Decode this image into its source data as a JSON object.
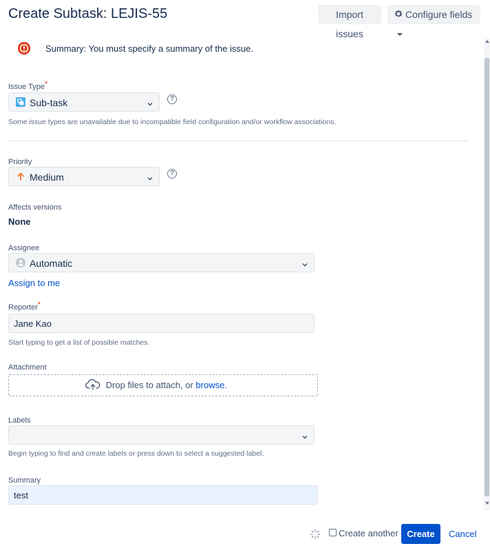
{
  "header": {
    "title": "Create Subtask: LEJIS-55",
    "import_label": "Import issues",
    "configure_label": "Configure fields"
  },
  "error": {
    "message": "Summary: You must specify a summary of the issue."
  },
  "issue_type": {
    "label": "Issue Type",
    "required_marker": "*",
    "value": "Sub-task",
    "note": "Some issue types are unavailable due to incompatible field configuration and/or workflow associations."
  },
  "priority": {
    "label": "Priority",
    "value": "Medium"
  },
  "affects_versions": {
    "label": "Affects versions",
    "value": "None"
  },
  "assignee": {
    "label": "Assignee",
    "value": "Automatic",
    "assign_to_me": "Assign to me"
  },
  "reporter": {
    "label": "Reporter",
    "required_marker": "*",
    "value": "Jane Kao",
    "note": "Start typing to get a list of possible matches."
  },
  "attachment": {
    "label": "Attachment",
    "drop_text": "Drop files to attach, or ",
    "browse_text": "browse."
  },
  "labels": {
    "label": "Labels",
    "value": "",
    "note": "Begin typing to find and create labels or press down to select a suggested label."
  },
  "summary": {
    "label": "Summary",
    "value": "test"
  },
  "footer": {
    "create_another_label": "Create another",
    "create_another_checked": false,
    "create_label": "Create",
    "cancel_label": "Cancel"
  },
  "colors": {
    "primary": "#0052cc",
    "error": "#de350b",
    "priority_medium": "#f97b2a",
    "subtask": "#4bade8"
  }
}
